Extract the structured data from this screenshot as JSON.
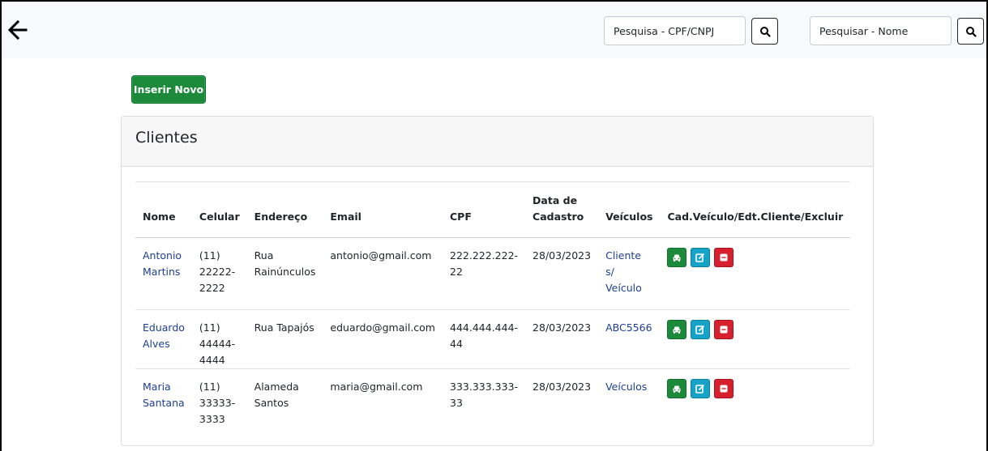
{
  "topbar": {
    "search_cpf": {
      "placeholder": "Pesquisa - CPF/CNPJ"
    },
    "search_name": {
      "placeholder": "Pesquisar - Nome"
    }
  },
  "actions": {
    "insert_label": "Inserir Novo"
  },
  "card": {
    "title": "Clientes"
  },
  "table": {
    "columns": [
      "Nome",
      "Celular",
      "Endereço",
      "Email",
      "CPF",
      "Data de Cadastro",
      "Veículos",
      "Cad.Veículo/Edt.Cliente/Excluir"
    ],
    "rows": [
      {
        "nome": "Antonio Martins",
        "celular": "(11) 22222-2222",
        "endereco": "Rua Rainúnculos",
        "email": "antonio@gmail.com",
        "cpf": "222.222.222-22",
        "data": "28/03/2023",
        "veiculos": "Cliente s/ Veículo"
      },
      {
        "nome": "Eduardo Alves",
        "celular": "(11) 44444-4444",
        "endereco": "Rua Tapajós",
        "email": "eduardo@gmail.com",
        "cpf": "444.444.444-44",
        "data": "28/03/2023",
        "veiculos": "ABC5566"
      },
      {
        "nome": "Maria Santana",
        "celular": "(11) 33333-3333",
        "endereco": "Alameda Santos",
        "email": "maria@gmail.com",
        "cpf": "333.333.333-33",
        "data": "28/03/2023",
        "veiculos": "Veículos"
      }
    ]
  },
  "icons": {
    "back": "arrow-left-icon",
    "search": "search-icon",
    "vehicle": "car-icon",
    "edit": "edit-icon",
    "delete": "delete-icon"
  },
  "colors": {
    "success": "#1c8a3a",
    "info": "#17a2c8",
    "danger": "#d6202e",
    "link": "#1c3f94"
  }
}
